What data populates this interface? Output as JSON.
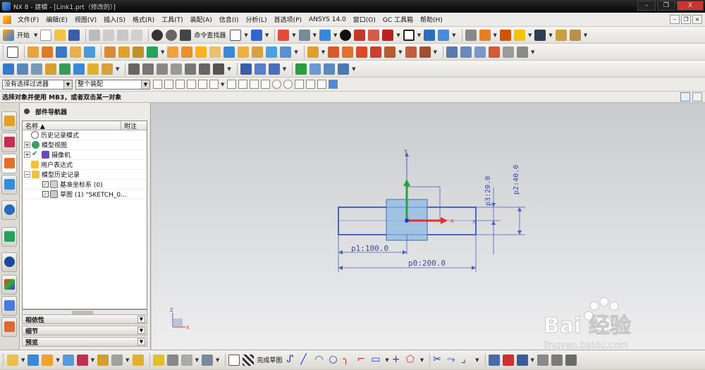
{
  "window": {
    "title": "NX 8 - 建模 - [Link1.prt（修改的）]",
    "close_label": "X"
  },
  "menubar": {
    "items": [
      "文件(F)",
      "编辑(E)",
      "视图(V)",
      "插入(S)",
      "格式(R)",
      "工具(T)",
      "装配(A)",
      "信息(I)",
      "分析(L)",
      "首选项(P)",
      "ANSYS 14.0",
      "窗口(O)",
      "GC 工具箱",
      "帮助(H)"
    ]
  },
  "toolbar1": {
    "start_label": "开始",
    "command_finder_label": "命令查找器"
  },
  "selection": {
    "filter_value": "没有选择过滤器",
    "scope_value": "整个装配"
  },
  "cue": {
    "text": "选择对象并使用 MB3，或者双击某一对象"
  },
  "navigator": {
    "title": "部件导航器",
    "columns": {
      "name": "名称",
      "note": "附注"
    },
    "rows": [
      {
        "label": "历史记录模式"
      },
      {
        "label": "模型视图"
      },
      {
        "label": "摄像机"
      },
      {
        "label": "用户表达式"
      },
      {
        "label": "模型历史记录"
      },
      {
        "label": "基准坐标系 (0)"
      },
      {
        "label": "草图 (1) \"SKETCH_0..."
      }
    ],
    "panels": [
      "相依性",
      "细节",
      "预览"
    ]
  },
  "sketch": {
    "dim_p0": "p0:200.0",
    "dim_p1": "p1:100.0",
    "dim_p2": "p2:40.0",
    "dim_p3": "p3:20.0",
    "axis_y": "Y",
    "axis_x": "X",
    "axis_z": "Z"
  },
  "bottombar": {
    "finish_sketch_label": "完成草图"
  },
  "watermark": {
    "brand": "Bai 经验",
    "url": "jingyan.baidu.com"
  },
  "colors": {
    "sketch_blue": "#1a3cc8",
    "dim_blue": "#4a5fc0",
    "square_fill": "#8fb9e3",
    "axis_green": "#2aa040",
    "axis_red": "#e03030"
  }
}
